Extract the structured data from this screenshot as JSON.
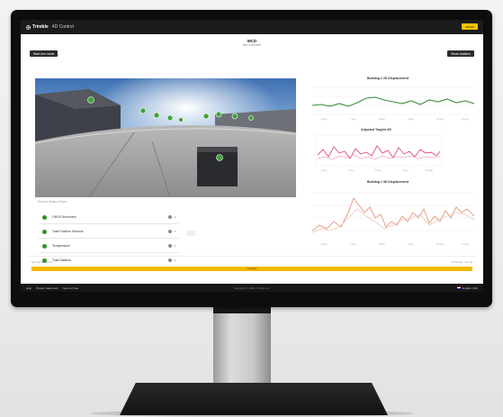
{
  "header": {
    "brand": "Trimble",
    "app_name": "4D Control",
    "user_badge": "ADMIN"
  },
  "project": {
    "title": "MCD",
    "subtitle": "site overview"
  },
  "actions": {
    "left_button": "Start live mode",
    "right_button": "Show stations"
  },
  "sensors": {
    "caption": "Sensor Status Panel",
    "items": [
      {
        "label": "GNSS Receivers"
      },
      {
        "label": "Total Position Sensors"
      },
      {
        "label": "Temperature"
      },
      {
        "label": "Total Stations"
      }
    ]
  },
  "charts": [
    {
      "title": "Building 2 2D Displacement",
      "color": "#3f8f3f"
    },
    {
      "title": "Adjusted Targets 2D",
      "color": "#e04a8a"
    },
    {
      "title": "Building 1 3D Displacement",
      "color": "#e4a08a"
    }
  ],
  "progress": {
    "left_label": "Schedule: normal",
    "right_label": "Schedule: normal",
    "bar_text": "Loading",
    "fraction": 1.0
  },
  "footer": {
    "links": [
      "Help",
      "Privacy Statement",
      "Terms of Use"
    ],
    "copyright": "Copyright © 2018, Trimble Inc.",
    "language": "English (US)"
  },
  "colors": {
    "accent": "#f2b800",
    "status_ok": "#2f8f2f",
    "topbar": "#1c1c1c"
  }
}
